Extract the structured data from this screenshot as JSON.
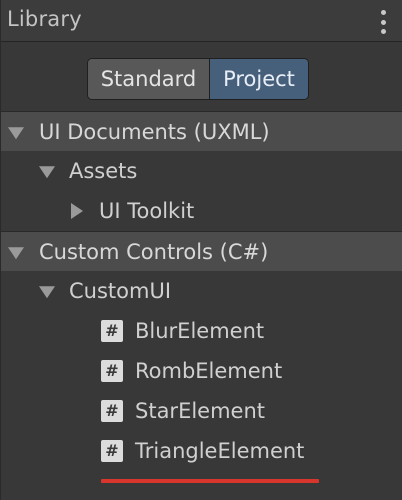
{
  "header": {
    "title": "Library",
    "menu_icon": "kebab-menu-icon"
  },
  "toggle": {
    "options": [
      "Standard",
      "Project"
    ],
    "selected": "Project"
  },
  "tree": {
    "ui_documents": {
      "label": "UI Documents (UXML)",
      "expanded": true,
      "assets": {
        "label": "Assets",
        "expanded": true,
        "ui_toolkit": {
          "label": "UI Toolkit",
          "expanded": false
        }
      }
    },
    "custom_controls": {
      "label": "Custom Controls (C#)",
      "expanded": true,
      "custom_ui": {
        "label": "CustomUI",
        "expanded": true,
        "items": [
          {
            "label": "BlurElement",
            "icon": "hash-icon"
          },
          {
            "label": "RombElement",
            "icon": "hash-icon"
          },
          {
            "label": "StarElement",
            "icon": "hash-icon"
          },
          {
            "label": "TriangleElement",
            "icon": "hash-icon"
          }
        ]
      }
    }
  },
  "icon_glyph": "#",
  "colors": {
    "panel_bg": "#383838",
    "category_bg": "#4c4c4c",
    "selected_toggle": "#46607c",
    "annotation_underline": "#d8362c"
  }
}
